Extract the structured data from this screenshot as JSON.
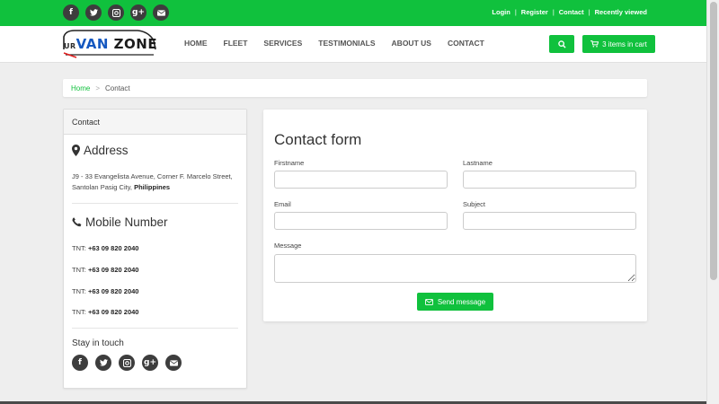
{
  "topbar": {
    "social_icons": [
      "facebook-icon",
      "twitter-icon",
      "instagram-icon",
      "google-plus-icon",
      "envelope-icon"
    ],
    "links": {
      "login": "Login",
      "register": "Register",
      "contact": "Contact",
      "recently_viewed": "Recently viewed"
    }
  },
  "logo": {
    "ur": "UR",
    "van": "VAN",
    "zone": "ZONE"
  },
  "nav": {
    "home": "HOME",
    "fleet": "FLEET",
    "services": "SERVICES",
    "testimonials": "TESTIMONIALS",
    "about": "ABOUT US",
    "contact": "CONTACT"
  },
  "cart": {
    "label": "3 items in cart"
  },
  "breadcrumb": {
    "home": "Home",
    "separator": ">",
    "current": "Contact"
  },
  "sidebar": {
    "title": "Contact",
    "address_heading": "Address",
    "address_text": "J9 - 33 Evangelista Avenue, Corner F. Marcelo Street, Santolan Pasig City,",
    "address_country": "Philippines",
    "mobile_heading": "Mobile Number",
    "phones": [
      {
        "carrier": "TNT:",
        "number": "+63 09 820 2040"
      },
      {
        "carrier": "TNT:",
        "number": "+63 09 820 2040"
      },
      {
        "carrier": "TNT:",
        "number": "+63 09 820 2040"
      },
      {
        "carrier": "TNT:",
        "number": "+63 09 820 2040"
      }
    ],
    "stay_in_touch": "Stay in touch"
  },
  "form": {
    "title": "Contact form",
    "firstname_label": "Firstname",
    "lastname_label": "Lastname",
    "email_label": "Email",
    "subject_label": "Subject",
    "message_label": "Message",
    "firstname_value": "",
    "lastname_value": "",
    "email_value": "",
    "subject_value": "",
    "message_value": "",
    "send_label": "Send message"
  },
  "colors": {
    "brand_green": "#10c13d",
    "icon_dark": "#3d3d3d",
    "logo_blue": "#1558c0"
  }
}
